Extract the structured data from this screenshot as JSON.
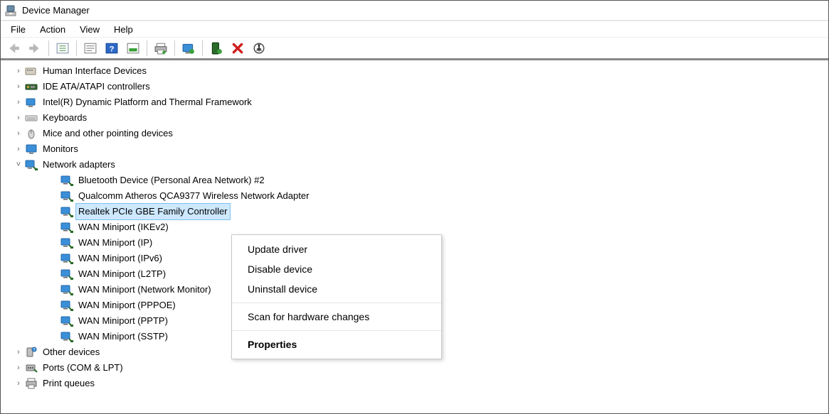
{
  "window": {
    "title": "Device Manager"
  },
  "menubar": {
    "items": [
      "File",
      "Action",
      "View",
      "Help"
    ]
  },
  "toolbar": {
    "buttons": [
      {
        "name": "arrow-left-icon",
        "disabled": true
      },
      {
        "name": "arrow-right-icon",
        "disabled": true
      },
      {
        "name": "sep"
      },
      {
        "name": "show-hide-tree-icon",
        "disabled": false
      },
      {
        "name": "sep"
      },
      {
        "name": "properties-icon",
        "disabled": false
      },
      {
        "name": "help-icon",
        "disabled": false
      },
      {
        "name": "refresh-icon",
        "disabled": false
      },
      {
        "name": "sep"
      },
      {
        "name": "print-icon",
        "disabled": false
      },
      {
        "name": "sep"
      },
      {
        "name": "update-driver-icon",
        "disabled": false
      },
      {
        "name": "sep"
      },
      {
        "name": "enable-device-icon",
        "disabled": false
      },
      {
        "name": "uninstall-icon",
        "disabled": false
      },
      {
        "name": "scan-hardware-icon",
        "disabled": false
      }
    ]
  },
  "tree": {
    "categories": [
      {
        "name": "hid",
        "label": "Human Interface Devices",
        "expanded": false,
        "icon": "hid-icon"
      },
      {
        "name": "ide",
        "label": "IDE ATA/ATAPI controllers",
        "expanded": false,
        "icon": "ide-icon"
      },
      {
        "name": "dptf",
        "label": "Intel(R) Dynamic Platform and Thermal Framework",
        "expanded": false,
        "icon": "platform-icon"
      },
      {
        "name": "keyboards",
        "label": "Keyboards",
        "expanded": false,
        "icon": "keyboard-icon"
      },
      {
        "name": "mice",
        "label": "Mice and other pointing devices",
        "expanded": false,
        "icon": "mouse-icon"
      },
      {
        "name": "monitors",
        "label": "Monitors",
        "expanded": false,
        "icon": "monitor-icon"
      },
      {
        "name": "net",
        "label": "Network adapters",
        "expanded": true,
        "icon": "net-icon",
        "children": [
          {
            "label": "Bluetooth Device (Personal Area Network) #2"
          },
          {
            "label": "Qualcomm Atheros QCA9377 Wireless Network Adapter"
          },
          {
            "label": "Realtek PCIe GBE Family Controller",
            "selected": true
          },
          {
            "label": "WAN Miniport (IKEv2)"
          },
          {
            "label": "WAN Miniport (IP)"
          },
          {
            "label": "WAN Miniport (IPv6)"
          },
          {
            "label": "WAN Miniport (L2TP)"
          },
          {
            "label": "WAN Miniport (Network Monitor)"
          },
          {
            "label": "WAN Miniport (PPPOE)"
          },
          {
            "label": "WAN Miniport (PPTP)"
          },
          {
            "label": "WAN Miniport (SSTP)"
          }
        ]
      },
      {
        "name": "other",
        "label": "Other devices",
        "expanded": false,
        "icon": "other-icon"
      },
      {
        "name": "ports",
        "label": "Ports (COM & LPT)",
        "expanded": false,
        "icon": "port-icon"
      },
      {
        "name": "printq",
        "label": "Print queues",
        "expanded": false,
        "icon": "printer-icon"
      }
    ]
  },
  "context_menu": {
    "items": [
      {
        "label": "Update driver"
      },
      {
        "label": "Disable device"
      },
      {
        "label": "Uninstall device"
      },
      {
        "sep": true
      },
      {
        "label": "Scan for hardware changes"
      },
      {
        "sep": true
      },
      {
        "label": "Properties",
        "bold": true
      }
    ]
  }
}
